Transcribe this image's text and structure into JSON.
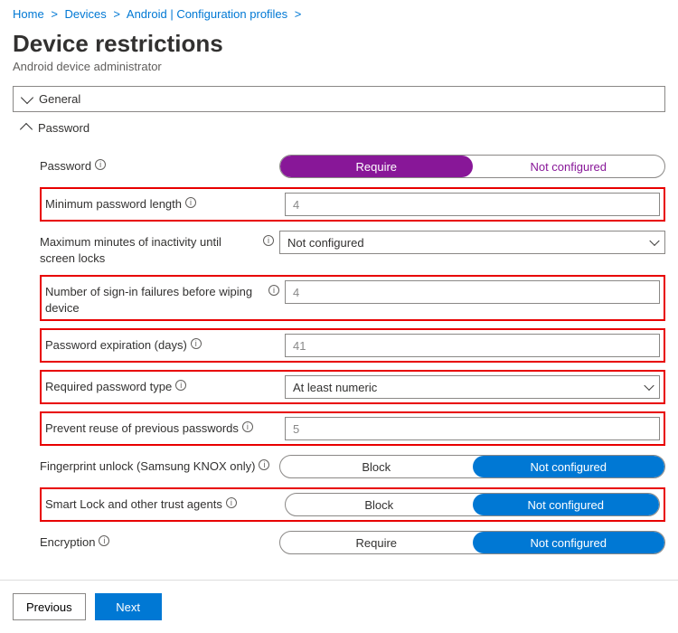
{
  "breadcrumb": {
    "home": "Home",
    "devices": "Devices",
    "android": "Android | Configuration profiles"
  },
  "title": "Device restrictions",
  "subtitle": "Android device administrator",
  "sections": {
    "general": "General",
    "password": "Password"
  },
  "labels": {
    "password": "Password",
    "minLen": "Minimum password length",
    "maxIdle": "Maximum minutes of inactivity until screen locks",
    "failures": "Number of sign-in failures before wiping device",
    "expire": "Password expiration (days)",
    "type": "Required password type",
    "reuse": "Prevent reuse of previous passwords",
    "fingerprint": "Fingerprint unlock (Samsung KNOX only)",
    "smartlock": "Smart Lock and other trust agents",
    "encryption": "Encryption"
  },
  "options": {
    "require": "Require",
    "notConfigured": "Not configured",
    "block": "Block"
  },
  "values": {
    "minLen": "4",
    "maxIdle": "Not configured",
    "failures": "4",
    "expire": "41",
    "type": "At least numeric",
    "reuse": "5"
  },
  "footer": {
    "previous": "Previous",
    "next": "Next"
  }
}
